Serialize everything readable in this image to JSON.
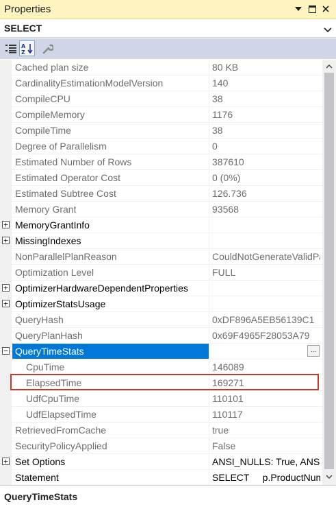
{
  "panel": {
    "title": "Properties"
  },
  "object": {
    "name": "SELECT"
  },
  "toolbar": {
    "categorized_icon": "categorized-view-icon",
    "alphabetical_icon": "alphabetical-sort-icon",
    "property_pages_icon": "wrench-icon"
  },
  "properties": [
    {
      "name": "Cached plan size",
      "value": "80 KB"
    },
    {
      "name": "CardinalityEstimationModelVersion",
      "value": "140"
    },
    {
      "name": "CompileCPU",
      "value": "38"
    },
    {
      "name": "CompileMemory",
      "value": "1176"
    },
    {
      "name": "CompileTime",
      "value": "38"
    },
    {
      "name": "Degree of Parallelism",
      "value": "0"
    },
    {
      "name": "Estimated Number of Rows",
      "value": "387610"
    },
    {
      "name": "Estimated Operator Cost",
      "value": "0 (0%)"
    },
    {
      "name": "Estimated Subtree Cost",
      "value": "126.736"
    },
    {
      "name": "Memory Grant",
      "value": "93568"
    },
    {
      "name": "MemoryGrantInfo",
      "value": ""
    },
    {
      "name": "MissingIndexes",
      "value": ""
    },
    {
      "name": "NonParallelPlanReason",
      "value": "CouldNotGenerateValidParallelPlan"
    },
    {
      "name": "Optimization Level",
      "value": "FULL"
    },
    {
      "name": "OptimizerHardwareDependentProperties",
      "value": ""
    },
    {
      "name": "OptimizerStatsUsage",
      "value": ""
    },
    {
      "name": "QueryHash",
      "value": "0xDF896A5EB56139C1"
    },
    {
      "name": "QueryPlanHash",
      "value": "0x69F4965F28053A79"
    },
    {
      "name": "QueryTimeStats",
      "value": ""
    },
    {
      "name": "CpuTime",
      "value": "146089"
    },
    {
      "name": "ElapsedTime",
      "value": "169271"
    },
    {
      "name": "UdfCpuTime",
      "value": "110101"
    },
    {
      "name": "UdfElapsedTime",
      "value": "110117"
    },
    {
      "name": "RetrievedFromCache",
      "value": "true"
    },
    {
      "name": "SecurityPolicyApplied",
      "value": "False"
    },
    {
      "name": "Set Options",
      "value": "ANSI_NULLS: True, ANSI_PADDING: True"
    },
    {
      "name": "Statement",
      "value": "SELECT     p.ProductNumber"
    }
  ],
  "ellipsis_label": "...",
  "description": {
    "title": "QueryTimeStats"
  },
  "colors": {
    "title_bar": "#fdf4bf",
    "toolbar": "#cfd6e5",
    "selection": "#0078d7",
    "highlight_border": "#c0392b"
  }
}
